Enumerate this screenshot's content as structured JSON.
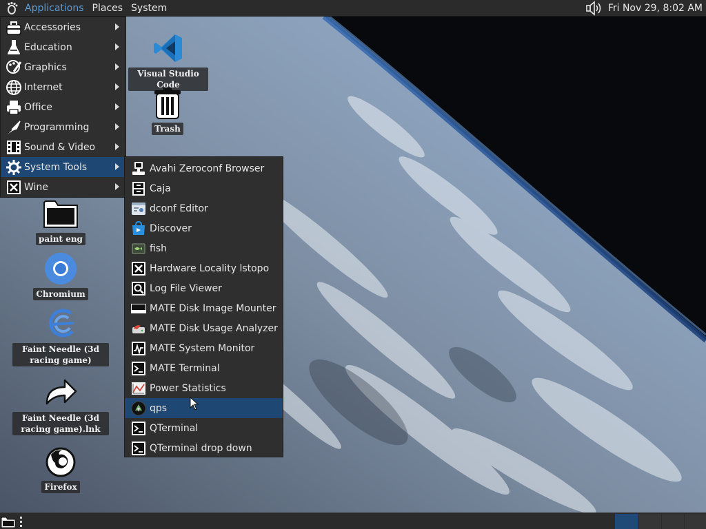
{
  "top_panel": {
    "menus": [
      "Applications",
      "Places",
      "System"
    ],
    "clock": "Fri Nov 29,  8:02 AM"
  },
  "desktop_icons": [
    {
      "label": "Visual Studio Code",
      "icon": "vscode-icon"
    },
    {
      "label": "Trash",
      "icon": "trash-icon"
    },
    {
      "label": "paint eng",
      "icon": "folder-icon"
    },
    {
      "label": "Chromium",
      "icon": "chromium-icon"
    },
    {
      "label": "Faint Needle (3d racing game)",
      "icon": "game-icon"
    },
    {
      "label": "Faint Needle (3d racing game).lnk",
      "icon": "shortcut-icon"
    },
    {
      "label": "Firefox",
      "icon": "firefox-icon"
    }
  ],
  "apps_menu": {
    "items": [
      {
        "label": "Accessories",
        "icon": "accessories-icon"
      },
      {
        "label": "Education",
        "icon": "education-icon"
      },
      {
        "label": "Graphics",
        "icon": "graphics-icon"
      },
      {
        "label": "Internet",
        "icon": "internet-icon"
      },
      {
        "label": "Office",
        "icon": "office-icon"
      },
      {
        "label": "Programming",
        "icon": "programming-icon"
      },
      {
        "label": "Sound & Video",
        "icon": "sound-video-icon"
      },
      {
        "label": "System Tools",
        "icon": "system-tools-icon",
        "selected": true
      },
      {
        "label": "Wine",
        "icon": "wine-icon"
      }
    ]
  },
  "submenu": {
    "items": [
      {
        "label": "Avahi Zeroconf Browser",
        "icon": "network-computer-icon"
      },
      {
        "label": "Caja",
        "icon": "file-cabinet-icon"
      },
      {
        "label": "dconf Editor",
        "icon": "dconf-icon"
      },
      {
        "label": "Discover",
        "icon": "discover-icon"
      },
      {
        "label": "fish",
        "icon": "fish-icon"
      },
      {
        "label": "Hardware Locality lstopo",
        "icon": "lstopo-icon"
      },
      {
        "label": "Log File Viewer",
        "icon": "log-viewer-icon"
      },
      {
        "label": "MATE Disk Image Mounter",
        "icon": "disk-mounter-icon"
      },
      {
        "label": "MATE Disk Usage Analyzer",
        "icon": "disk-usage-icon"
      },
      {
        "label": "MATE System Monitor",
        "icon": "system-monitor-icon"
      },
      {
        "label": "MATE Terminal",
        "icon": "terminal-icon"
      },
      {
        "label": "Power Statistics",
        "icon": "power-stats-icon"
      },
      {
        "label": "qps",
        "icon": "qps-icon",
        "selected": true
      },
      {
        "label": "QTerminal",
        "icon": "qterminal-icon"
      },
      {
        "label": "QTerminal drop down",
        "icon": "qterminal-dropdown-icon"
      }
    ]
  },
  "colors": {
    "panel": "#2b2b2b",
    "menu_bg": "#2f2f2f",
    "selection": "#1e4873",
    "applications_active": "#5b9bd5"
  }
}
